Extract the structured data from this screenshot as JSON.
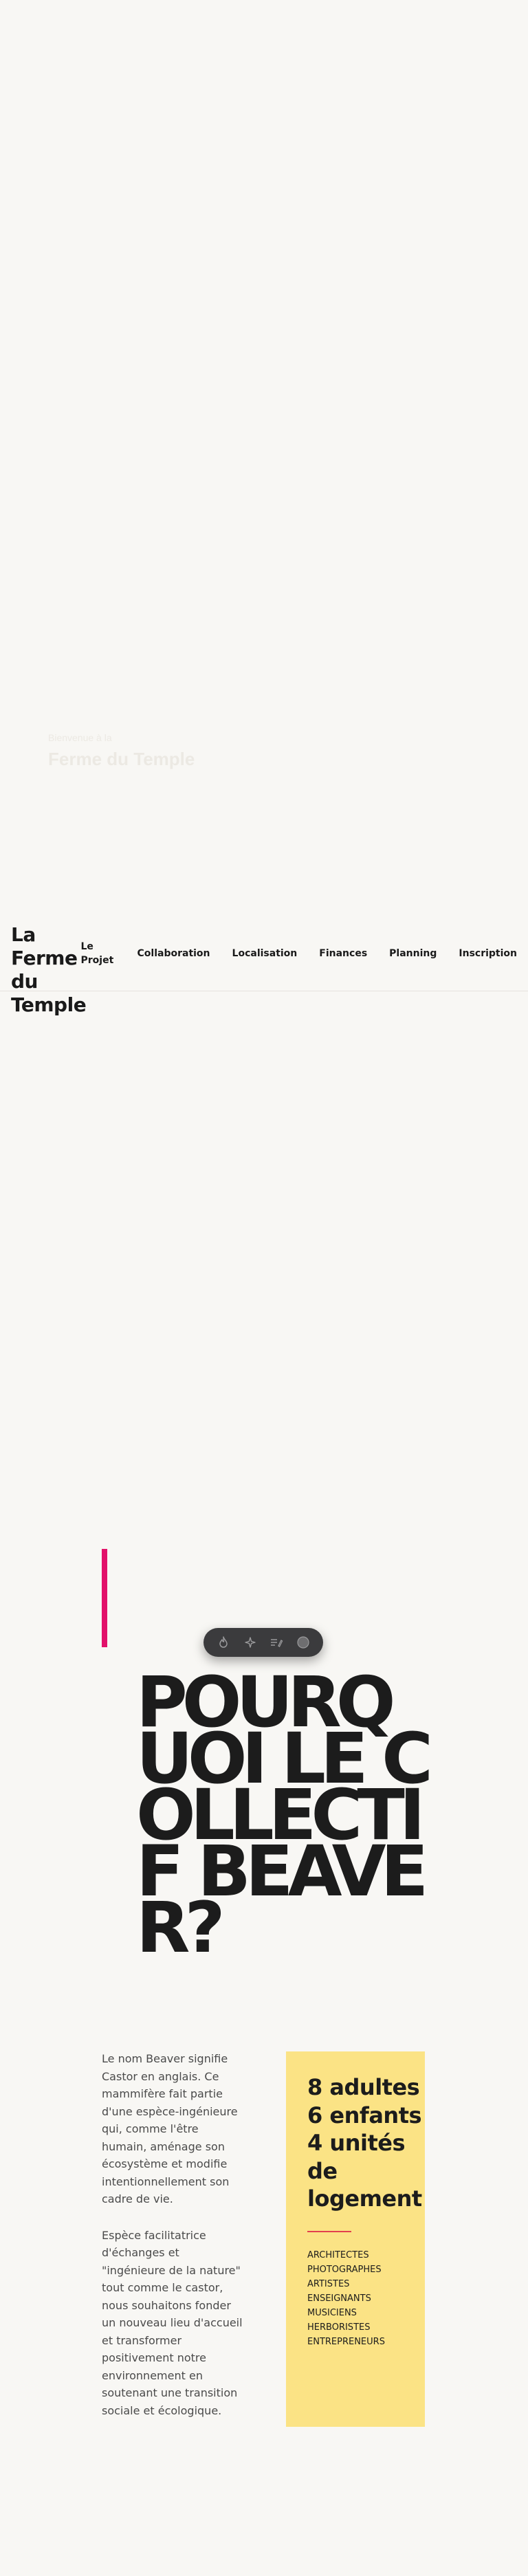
{
  "hero": {
    "faint_line_1": "Bienvenue à la",
    "faint_line_2": "Ferme du Temple"
  },
  "header": {
    "logo_lines": [
      "La Ferme",
      "du",
      "Temple"
    ],
    "nav": [
      {
        "label_line_1": "Le",
        "label_line_2": "Projet"
      },
      {
        "label": "Collaboration"
      },
      {
        "label": "Localisation"
      },
      {
        "label": "Finances"
      },
      {
        "label": "Planning"
      },
      {
        "label": "Inscription"
      }
    ]
  },
  "toolbar": {
    "icons": [
      "flame-icon",
      "sparkles-icon",
      "list-edit-icon",
      "record-icon"
    ]
  },
  "section": {
    "title": "POURQUOI LE COLLECTIF BEAVER?",
    "paragraphs": [
      "Le nom Beaver signifie Castor en anglais. Ce mammifère fait partie d'une espèce-ingénieure qui, comme l'être humain, aménage son écosystème et modifie intentionnellement son cadre de vie.",
      "Espèce facilitatrice d'échanges et \"ingénieure de la nature\" tout comme le castor, nous souhaitons fonder un nouveau lieu d'accueil et transformer positivement notre environnement en soutenant une transition sociale et écologique."
    ],
    "stats": [
      "8 adultes",
      "6 enfants",
      "4 unités de logement"
    ],
    "professions": [
      "ARCHITECTES",
      "PHOTOGRAPHES",
      "ARTISTES",
      "ENSEIGNANTS",
      "MUSICIENS",
      "HERBORISTES",
      "ENTREPRENEURS"
    ]
  },
  "colors": {
    "background": "#f8f7f4",
    "accent_pink": "#e2126a",
    "card_yellow": "#fbe385",
    "divider_red": "#e2404f",
    "text_dark": "#1c1c1c",
    "toolbar_bg": "#3b3b3d"
  }
}
